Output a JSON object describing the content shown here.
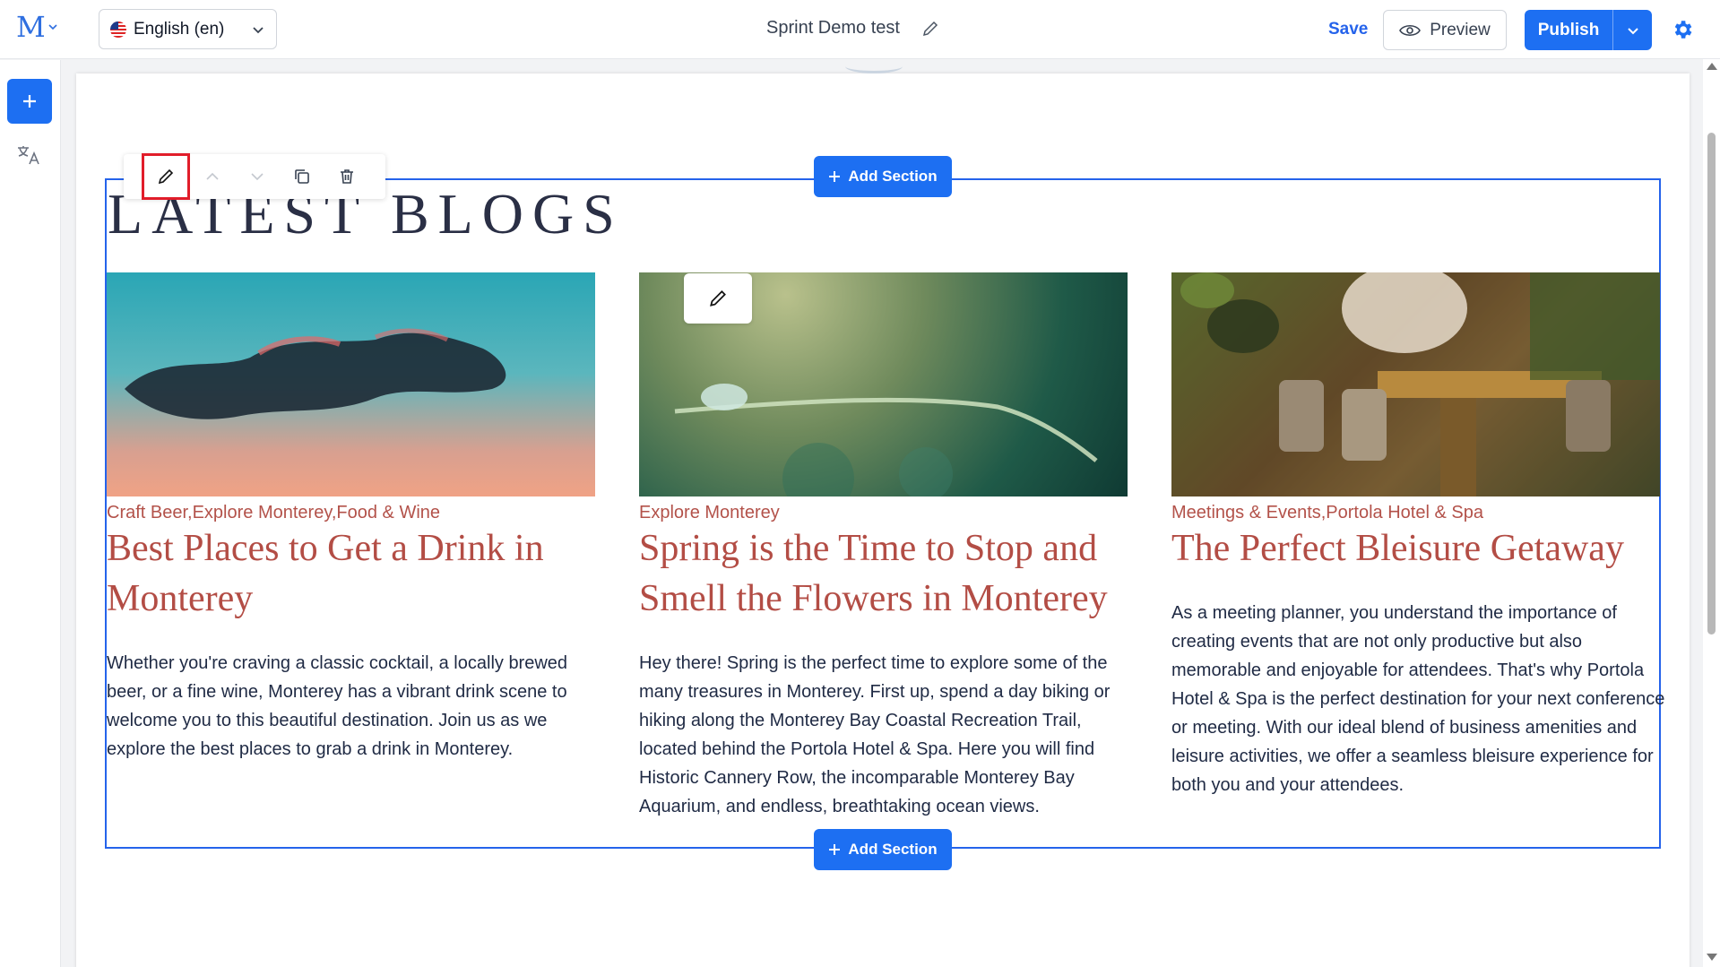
{
  "header": {
    "logo_letter": "M",
    "language": "English (en)",
    "document_title": "Sprint Demo test",
    "save_label": "Save",
    "preview_label": "Preview",
    "publish_label": "Publish"
  },
  "section": {
    "add_section_label": "Add Section",
    "heading": "LATEST BLOGS"
  },
  "blogs": [
    {
      "categories": "Craft Beer,Explore Monterey,Food & Wine",
      "title": "Best Places to Get a Drink in Monterey",
      "excerpt": "Whether you're craving a classic cocktail, a locally brewed beer, or a fine wine, Monterey has a vibrant drink scene to welcome you to this beautiful destination. Join us as we explore the best places to grab a drink in Monterey."
    },
    {
      "categories": "Explore Monterey",
      "title": "Spring is the Time to Stop and Smell the Flowers in Monterey",
      "excerpt": "Hey there! Spring is the perfect time to explore some of the many treasures in Monterey. First up, spend a day biking or hiking along the Monterey Bay Coastal Recreation Trail, located behind the Portola Hotel & Spa. Here you will find Historic Cannery Row, the incomparable Monterey Bay Aquarium, and endless, breathtaking ocean views."
    },
    {
      "categories": "Meetings & Events,Portola Hotel & Spa",
      "title": "The Perfect Bleisure Getaway",
      "excerpt": "As a meeting planner, you understand the importance of creating events that are not only productive but also memorable and enjoyable for attendees. That's why Portola Hotel & Spa is the perfect destination for your next conference or meeting. With our ideal blend of business amenities and leisure activities, we offer a seamless bleisure experience for both you and your attendees."
    }
  ],
  "colors": {
    "accent": "#1d6ff2",
    "blog_title": "#b34d45",
    "selection_outline": "#2563eb",
    "highlight": "#e11d2a"
  }
}
